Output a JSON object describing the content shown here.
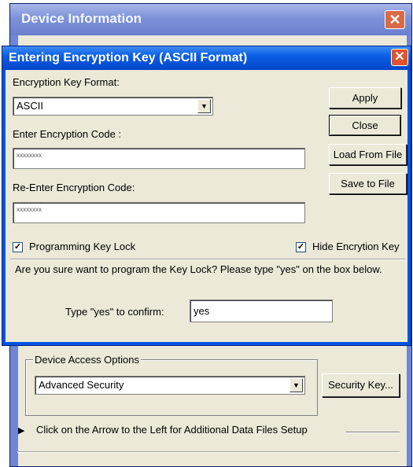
{
  "background_window": {
    "title": "Device Information",
    "close_label": "✕",
    "device_access": {
      "group_label": "Device Access Options",
      "selected": "Advanced Security",
      "security_key_button": "Security Key..."
    },
    "expander_text": "Click on the Arrow to the Left for Additional Data Files Setup"
  },
  "dialog": {
    "title": "Entering Encryption Key (ASCII Format)",
    "close_label": "✕",
    "key_format_label": "Encryption Key Format:",
    "key_format_value": "ASCII",
    "enter_code_label": "Enter Encryption Code :",
    "enter_code_value": "xxxxxxxx",
    "reenter_code_label": "Re-Enter Encryption Code:",
    "reenter_code_value": "xxxxxxxx",
    "buttons": {
      "apply": "Apply",
      "close": "Close",
      "load_from_file": "Load From File",
      "save_to_file": "Save to File"
    },
    "programming_key_lock": {
      "label": "Programming Key Lock",
      "checked": true
    },
    "hide_encryption_key": {
      "label": "Hide Encrytion Key",
      "checked": true
    },
    "confirm": {
      "message": "Are you sure want to program the Key Lock? Please type \"yes\" on the box below.",
      "prompt_label": "Type \"yes\" to confirm:",
      "value": "yes"
    }
  }
}
